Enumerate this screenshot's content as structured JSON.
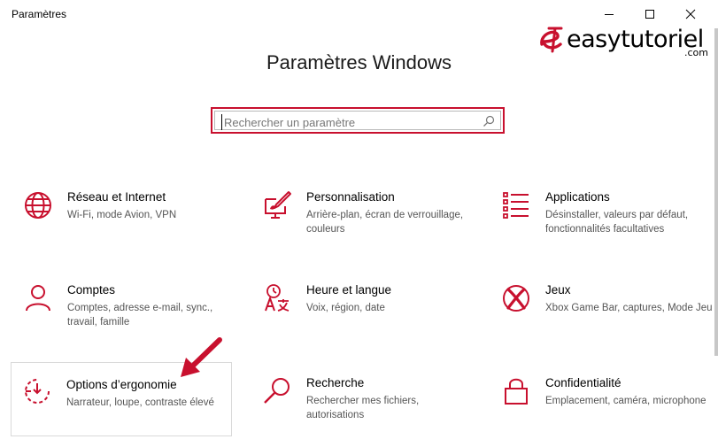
{
  "window": {
    "title": "Paramètres",
    "minimize_glyph": "minimize-icon",
    "maximize_glyph": "maximize-icon",
    "close_glyph": "close-icon"
  },
  "logo": {
    "text": "easytutoriel",
    "sub": ".com"
  },
  "page": {
    "title": "Paramètres Windows"
  },
  "search": {
    "placeholder": "Rechercher un paramètre",
    "value": ""
  },
  "colors": {
    "accent": "#c8102e",
    "icon": "#c8102e"
  },
  "tiles": [
    {
      "name": "Réseau et Internet",
      "desc": "Wi-Fi, mode Avion, VPN",
      "icon": "globe-icon"
    },
    {
      "name": "Personnalisation",
      "desc": "Arrière-plan, écran de verrouillage, couleurs",
      "icon": "personalization-icon"
    },
    {
      "name": "Applications",
      "desc": "Désinstaller, valeurs par défaut, fonctionnalités facultatives",
      "icon": "apps-list-icon"
    },
    {
      "name": "Comptes",
      "desc": "Comptes, adresse e-mail, sync., travail, famille",
      "icon": "person-icon"
    },
    {
      "name": "Heure et langue",
      "desc": "Voix, région, date",
      "icon": "time-language-icon"
    },
    {
      "name": "Jeux",
      "desc": "Xbox Game Bar, captures, Mode Jeu",
      "icon": "xbox-icon"
    },
    {
      "name": "Options d’ergonomie",
      "desc": "Narrateur, loupe, contraste élevé",
      "icon": "ease-of-access-icon"
    },
    {
      "name": "Recherche",
      "desc": "Rechercher mes fichiers, autorisations",
      "icon": "search-icon"
    },
    {
      "name": "Confidentialité",
      "desc": "Emplacement, caméra, microphone",
      "icon": "lock-icon"
    }
  ]
}
